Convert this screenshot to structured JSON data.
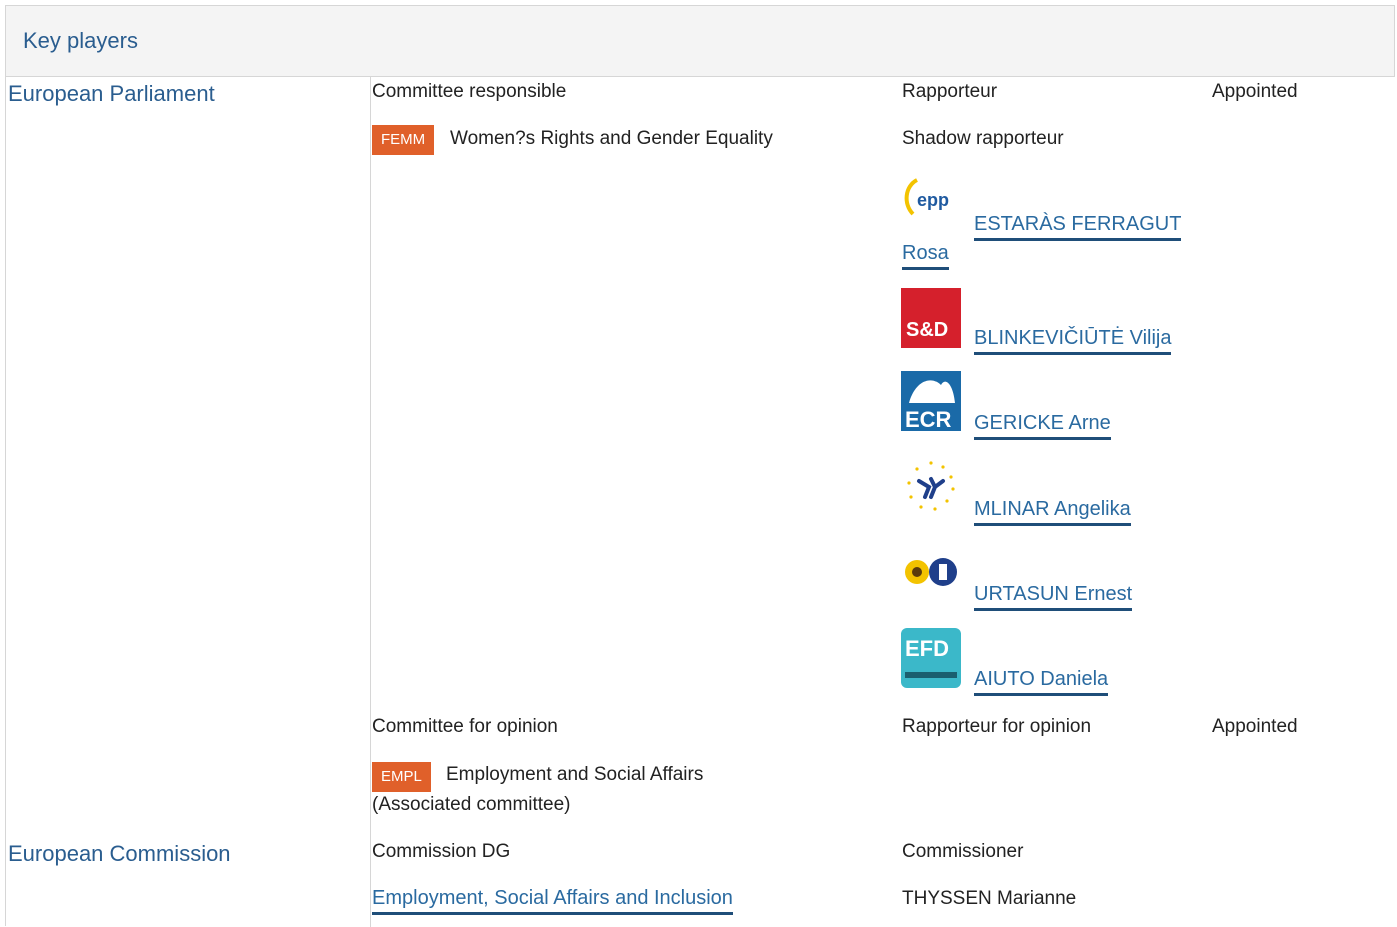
{
  "header": {
    "title": "Key players"
  },
  "parliament": {
    "label": "European Parliament",
    "committee_responsible_label": "Committee responsible",
    "rapporteur_label": "Rapporteur",
    "appointed_label": "Appointed",
    "femm_badge": "FEMM",
    "femm_name": "Women?s Rights and Gender Equality",
    "shadow_label": "Shadow rapporteur",
    "shadows": [
      {
        "group_logo": "EPP group logo",
        "logo_text": "epp",
        "name_line1": "ESTARÀS FERRAGUT",
        "name_line2": "Rosa"
      },
      {
        "group_logo": "S&D group logo",
        "logo_text": "S&D",
        "name": "BLINKEVIČIŪTĖ Vilija"
      },
      {
        "group_logo": "ECR group logo",
        "logo_text": "ECR",
        "name": "GERICKE Arne"
      },
      {
        "group_logo": "ALDE group logo",
        "name": "MLINAR Angelika"
      },
      {
        "group_logo": "Greens/EFA group logo",
        "name": "URTASUN Ernest"
      },
      {
        "group_logo": "EFD group logo",
        "logo_text": "EFD",
        "name": "AIUTO Daniela"
      }
    ],
    "opinion_label": "Committee for opinion",
    "rapporteur_opinion_label": "Rapporteur for opinion",
    "appointed_opinion_label": "Appointed",
    "empl_badge": "EMPL",
    "empl_name": "Employment and Social Affairs",
    "empl_note": "(Associated committee)"
  },
  "commission": {
    "label": "European Commission",
    "dg_label": "Commission DG",
    "commissioner_label": "Commissioner",
    "dg_link": "Employment, Social Affairs and Inclusion",
    "commissioner_name": "THYSSEN Marianne"
  },
  "colors": {
    "accent": "#2a5d8f",
    "badge": "#e0602a",
    "link_underline": "#1f4e79"
  }
}
